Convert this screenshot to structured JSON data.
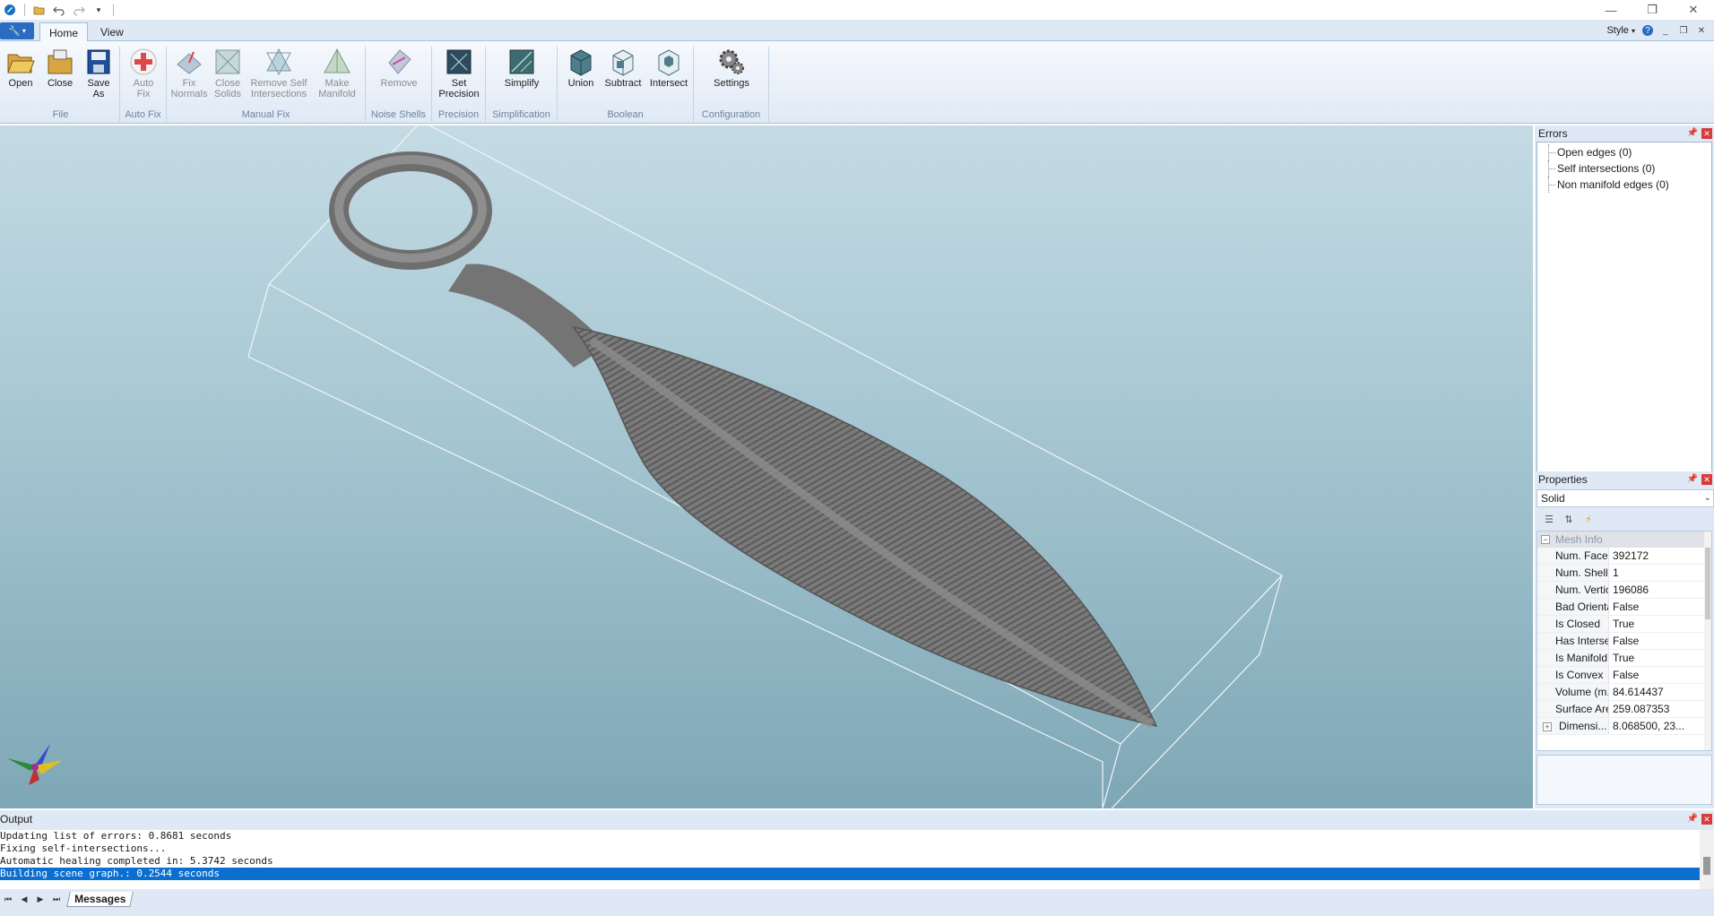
{
  "ribbon": {
    "tabs": [
      "Home",
      "View"
    ],
    "style_label": "Style",
    "groups": [
      {
        "label": "File",
        "buttons": [
          "Open",
          "Close",
          "Save As"
        ]
      },
      {
        "label": "Auto Fix",
        "buttons": [
          "Auto Fix"
        ]
      },
      {
        "label": "Manual Fix",
        "buttons": [
          "Fix Normals",
          "Close Solids",
          "Remove Self Intersections",
          "Make Manifold"
        ]
      },
      {
        "label": "Noise Shells",
        "buttons": [
          "Remove"
        ]
      },
      {
        "label": "Precision",
        "buttons": [
          "Set Precision"
        ]
      },
      {
        "label": "Simplification",
        "buttons": [
          "Simplify"
        ]
      },
      {
        "label": "Boolean",
        "buttons": [
          "Union",
          "Subtract",
          "Intersect"
        ]
      },
      {
        "label": "Configuration",
        "buttons": [
          "Settings"
        ]
      }
    ]
  },
  "errors_panel": {
    "title": "Errors",
    "items": [
      "Open edges (0)",
      "Self intersections (0)",
      "Non manifold edges (0)"
    ]
  },
  "properties_panel": {
    "title": "Properties",
    "selected": "Solid",
    "category": "Mesh Info",
    "rows": [
      {
        "key": "Num. Faces",
        "value": "392172"
      },
      {
        "key": "Num. Shells",
        "value": "1"
      },
      {
        "key": "Num. Vertices",
        "value": "196086"
      },
      {
        "key": "Bad Orienta...",
        "value": "False"
      },
      {
        "key": "Is Closed",
        "value": "True"
      },
      {
        "key": "Has Intersects",
        "value": "False"
      },
      {
        "key": "Is Manifold",
        "value": "True"
      },
      {
        "key": "Is Convex",
        "value": "False"
      },
      {
        "key": "Volume (m...",
        "value": "84.614437"
      },
      {
        "key": "Surface Are...",
        "value": "259.087353"
      },
      {
        "key": "Dimensi...",
        "value": "8.068500, 23..."
      }
    ]
  },
  "output_panel": {
    "title": "Output",
    "lines": [
      "Updating list of errors: 0.8681 seconds",
      "Fixing self-intersections...",
      "Automatic healing completed in: 5.3742 seconds",
      "Building scene graph.: 0.2544 seconds"
    ],
    "tab": "Messages"
  }
}
